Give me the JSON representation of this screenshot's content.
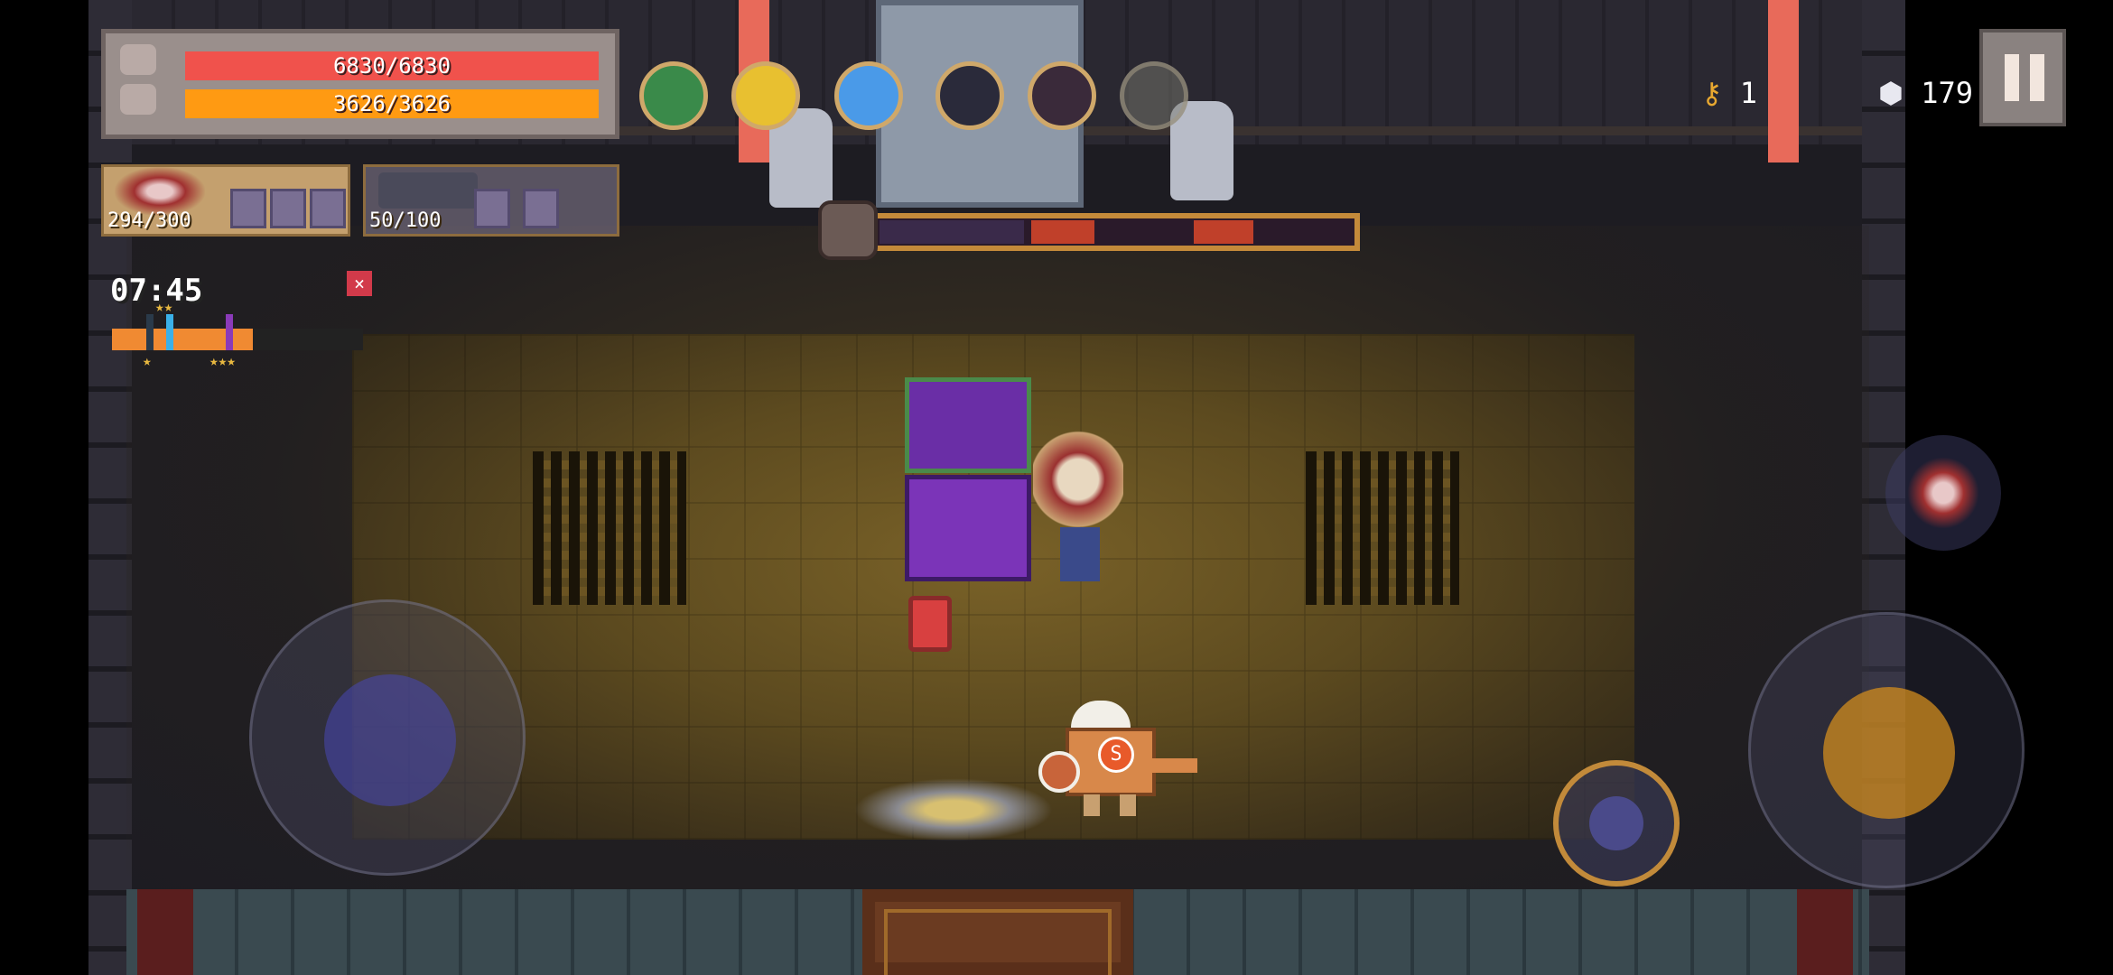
{
  "hud": {
    "hp_text": "6830/6830",
    "energy_text": "3626/3626",
    "hp_fraction": 1.0,
    "energy_fraction": 1.0
  },
  "weapons": [
    {
      "ammo_text": "294/300",
      "icon": "chaos-flower-weapon-icon"
    },
    {
      "ammo_text": "50/100",
      "icon": "ray-gun-weapon-icon"
    }
  ],
  "buffs": [
    "purple-gem-buff-icon",
    "yellow-orb-buff-icon",
    "ice-shard-buff-icon",
    "monkey-buff-icon",
    "potion-buff-icon",
    "empty-buff-slot"
  ],
  "timer": "07:45",
  "close_label": "×",
  "wave_progress": 0.56,
  "keys": {
    "count": "1"
  },
  "gems": {
    "count": "179"
  },
  "boss": {
    "health_fraction": 0.95
  },
  "robot": {
    "emblem": "S"
  },
  "colors": {
    "hp": "#f0524c",
    "energy": "#ff9a12",
    "attack_button": "#d28c1e",
    "boss_bar_border": "#c48a3a"
  }
}
